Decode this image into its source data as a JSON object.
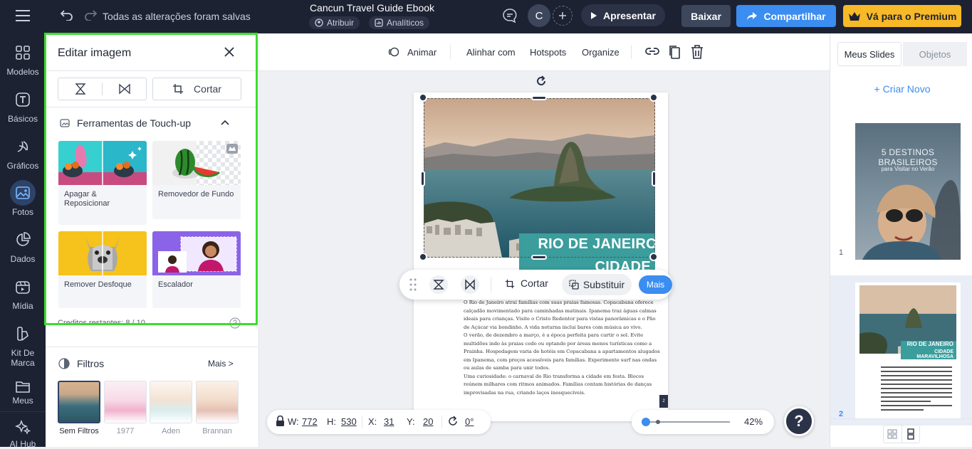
{
  "topbar": {
    "save_status": "Todas as alterações foram salvas",
    "doc_title": "Cancun Travel Guide Ebook",
    "assign_label": "Atribuir",
    "analytics_label": "Analíticos",
    "avatar_initial": "C",
    "present_label": "Apresentar",
    "download_label": "Baixar",
    "share_label": "Compartilhar",
    "premium_label": "Vá para o Premium"
  },
  "rail": {
    "items": [
      {
        "label": "Modelos",
        "icon": "grid-icon"
      },
      {
        "label": "Básicos",
        "icon": "text-icon"
      },
      {
        "label": "Gráficos",
        "icon": "shapes-icon"
      },
      {
        "label": "Fotos",
        "icon": "photo-icon"
      },
      {
        "label": "Dados",
        "icon": "chart-icon"
      },
      {
        "label": "Mídia",
        "icon": "media-icon"
      },
      {
        "label": "Kit De Marca",
        "icon": "brand-icon"
      },
      {
        "label": "Meus",
        "icon": "folder-icon"
      },
      {
        "label": "AI Hub",
        "icon": "sparkle-icon"
      }
    ]
  },
  "panel": {
    "title": "Editar imagem",
    "crop_label": "Cortar",
    "touchup_title": "Ferramentas de Touch-up",
    "tools": [
      {
        "label": "Apagar & Reposicionar"
      },
      {
        "label": "Removedor de Fundo"
      },
      {
        "label": "Remover Desfoque"
      },
      {
        "label": "Escalador"
      }
    ],
    "credits": "Creditos restantes: 8 / 10",
    "filters_title": "Filtros",
    "filters_more": "Mais >",
    "filters": [
      {
        "label": "Sem Filtros"
      },
      {
        "label": "1977"
      },
      {
        "label": "Aden"
      },
      {
        "label": "Brannan"
      }
    ]
  },
  "toolbar": {
    "animate": "Animar",
    "align": "Alinhar com",
    "hotspots": "Hotspots",
    "organize": "Organize"
  },
  "page": {
    "title_line1": "RIO DE JANEIRO",
    "title_line2": "CIDADE MARAVILHOSA",
    "paragraphs": [
      "O Rio de Janeiro atrai famílias com suas praias famosas. Copacabana oferece calçadão movimentado para caminhadas matinais. Ipanema traz águas calmas ideais para crianças. Visite o Cristo Redentor para vistas panorâmicas e o Pão de Açúcar via bondinho. A vida noturna inclui bares com música ao vivo.",
      "O verão, de dezembro a março, é a época perfeita para curtir o sol. Evite multidões indo às praias cedo ou optando por áreas menos turísticas como a Prainha. Hospedagem varia de hotéis em Copacabana a apartamentos alugados em Ipanema, com preços acessíveis para famílias. Experimente surf nas ondas ou aulas de samba para unir todos.",
      "Uma curiosidade: o carnaval do Rio transforma a cidade em festa. Blocos reúnem milhares com ritmos animados. Famílias contam histórias de danças improvisadas na rua, criando laços inesquecíveis."
    ],
    "page_number": "2"
  },
  "float_toolbar": {
    "crop": "Cortar",
    "replace": "Substituir",
    "more": "Mais"
  },
  "dims": {
    "w_label": "W:",
    "w": "772",
    "h_label": "H:",
    "h": "530",
    "x_label": "X:",
    "x": "31",
    "y_label": "Y:",
    "y": "20",
    "rotation": "0°"
  },
  "zoom": {
    "value": "42%",
    "level": 0.0
  },
  "help_label": "?",
  "rpanel": {
    "tab_slides": "Meus Slides",
    "tab_objects": "Objetos",
    "create_new": "+ Criar Novo",
    "slides": [
      {
        "number": "1",
        "title": "5 DESTINOS BRASILEIROS",
        "subtitle": "para Visitar no Verão"
      },
      {
        "number": "2",
        "title_line1": "RIO DE JANEIRO",
        "title_line2": "CIDADE MARAVILHOSA"
      }
    ]
  },
  "colors": {
    "topbar_bg": "#1d2233",
    "accent_blue": "#3b8df0",
    "premium_yellow": "#f7b927",
    "highlight_green": "#3ddc2e",
    "title_band": "#3b9d9c"
  }
}
